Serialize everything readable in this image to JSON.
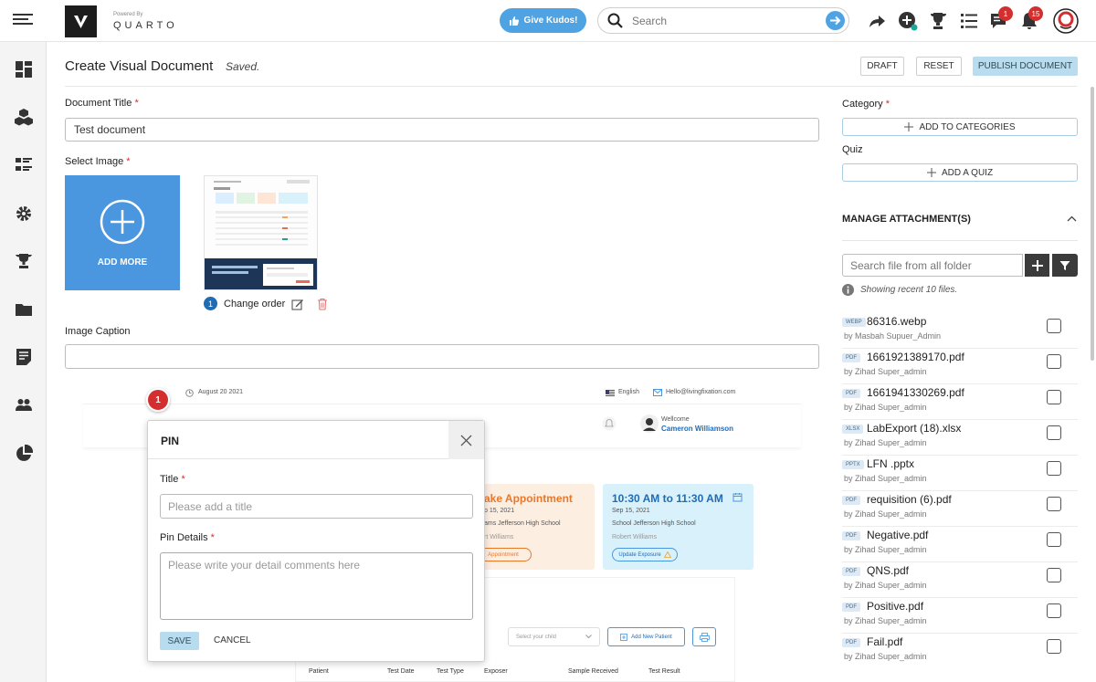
{
  "topbar": {
    "powered_by": "Powered By",
    "brand": "QUARTO",
    "kudos_label": "Give Kudos!",
    "search_placeholder": "Search",
    "notifications": [
      {
        "name": "chat-badge",
        "count": "1"
      },
      {
        "name": "bell-badge",
        "count": "15"
      }
    ]
  },
  "header": {
    "title": "Create Visual Document",
    "status": "Saved.",
    "draft_label": "DRAFT",
    "reset_label": "RESET",
    "publish_label": "PUBLISH DOCUMENT"
  },
  "form": {
    "doc_title_label": "Document Title",
    "doc_title_value": "Test document",
    "select_image_label": "Select Image",
    "add_more_label": "ADD MORE",
    "image_order": "1",
    "change_order_label": "Change order",
    "caption_label": "Image Caption",
    "caption_value": ""
  },
  "preview": {
    "date": "August 20 2021",
    "language": "English",
    "email": "Hello@livingfixation.com",
    "welcome": "Wellcome",
    "user_name": "Cameron Williamson",
    "card1_title": "ake Appointment",
    "card1_date": "p 15, 2021",
    "card1_school": "ams Jefferson High School",
    "card1_person": "rt Williams",
    "card1_button": "Appointment",
    "card2_title": "10:30 AM to 11:30 AM",
    "card2_date": "Sep 15, 2021",
    "card2_school": "School Jefferson High School",
    "card2_person": "Robert Williams",
    "card2_button": "Update Exposure",
    "select_child": "Select your child",
    "add_patient": "Add New Patient",
    "table_headers": [
      "Patient",
      "Test Date",
      "Test Type",
      "Exposer",
      "Sample Received",
      "Test Result"
    ]
  },
  "pin_marker": "1",
  "pin_modal": {
    "heading": "PIN",
    "title_label": "Title",
    "title_placeholder": "Please add a title",
    "details_label": "Pin Details",
    "details_placeholder": "Please write your detail comments here",
    "save_label": "SAVE",
    "cancel_label": "CANCEL"
  },
  "right_panel": {
    "category_label": "Category",
    "add_categories": "ADD TO CATEGORIES",
    "quiz_label": "Quiz",
    "add_quiz": "ADD A QUIZ",
    "attachments_heading": "MANAGE ATTACHMENT(S)",
    "search_placeholder": "Search file from all folder",
    "showing_note": "Showing recent 10 files.",
    "files": [
      {
        "type": "WEBP",
        "name": "86316.webp",
        "by": "by Masbah Supuer_Admin"
      },
      {
        "type": "PDF",
        "name": "1661921389170.pdf",
        "by": "by Zihad Super_admin"
      },
      {
        "type": "PDF",
        "name": "1661941330269.pdf",
        "by": "by Zihad Super_admin"
      },
      {
        "type": "XLSX",
        "name": "LabExport (18).xlsx",
        "by": "by Zihad Super_admin"
      },
      {
        "type": "PPTX",
        "name": "LFN .pptx",
        "by": "by Zihad Super_admin"
      },
      {
        "type": "PDF",
        "name": "requisition (6).pdf",
        "by": "by Zihad Super_admin"
      },
      {
        "type": "PDF",
        "name": "Negative.pdf",
        "by": "by Zihad Super_admin"
      },
      {
        "type": "PDF",
        "name": "QNS.pdf",
        "by": "by Zihad Super_admin"
      },
      {
        "type": "PDF",
        "name": "Positive.pdf",
        "by": "by Zihad Super_admin"
      },
      {
        "type": "PDF",
        "name": "Fail.pdf",
        "by": "by Zihad Super_admin"
      }
    ]
  },
  "colors": {
    "accent": "#4a97df",
    "danger": "#d32f2f",
    "save_button": "#b7dcef"
  }
}
